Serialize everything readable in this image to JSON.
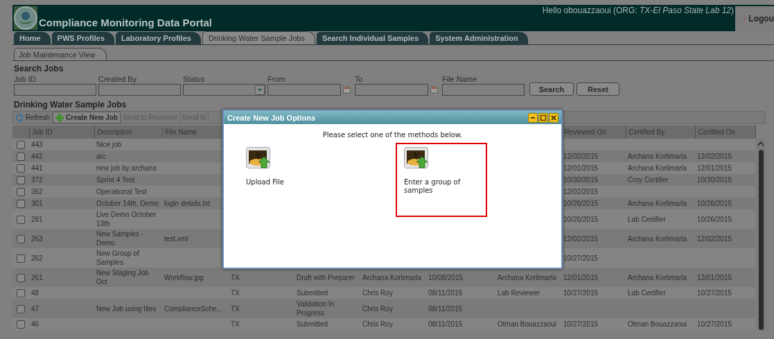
{
  "header": {
    "title": "Compliance Monitoring Data Portal",
    "greeting": "Hello obouazzaoui (ORG: *TX-El Paso State Lab 12*)",
    "logout": "Logou"
  },
  "tabs": [
    {
      "label": "Home",
      "selected": false
    },
    {
      "label": "PWS Profiles",
      "selected": false
    },
    {
      "label": "Laboratory Profiles",
      "selected": false
    },
    {
      "label": "Drinking Water Sample Jobs",
      "selected": true
    },
    {
      "label": "Search Individual Samples",
      "selected": false
    },
    {
      "label": "System Administration",
      "selected": false
    }
  ],
  "subtabs": [
    {
      "label": "Job Maintenance View",
      "selected": true
    }
  ],
  "search": {
    "title": "Search Jobs",
    "fields": [
      {
        "label": "Job ID",
        "kind": "text"
      },
      {
        "label": "Created By",
        "kind": "text"
      },
      {
        "label": "Status",
        "kind": "select"
      },
      {
        "label": "From",
        "kind": "date"
      },
      {
        "label": "To",
        "kind": "date"
      },
      {
        "label": "File Name",
        "kind": "text"
      }
    ],
    "buttons": [
      "Search",
      "Reset"
    ]
  },
  "grid": {
    "title": "Drinking Water Sample Jobs",
    "toolbar": [
      {
        "label": "Refresh",
        "kind": "refresh",
        "disabled": false
      },
      {
        "label": "Create New Job",
        "kind": "create",
        "disabled": false
      },
      {
        "label": "Send to Reviewer",
        "kind": "plain",
        "disabled": true
      },
      {
        "label": "Send to",
        "kind": "plain",
        "disabled": true
      }
    ],
    "columns": [
      "Job ID",
      "Description",
      "File Name",
      null,
      null,
      null,
      null,
      null,
      "Reviewed On",
      "Certified By",
      "Certified On"
    ],
    "rows": [
      {
        "checked": false,
        "cells": [
          "443",
          "Nice job",
          null,
          null,
          null,
          null,
          null,
          null,
          null,
          null,
          null
        ]
      },
      {
        "checked": false,
        "cells": [
          "442",
          "arc",
          null,
          null,
          null,
          null,
          null,
          null,
          "12/02/2015",
          "Archana Korlimarla",
          "12/02/2015"
        ]
      },
      {
        "checked": false,
        "cells": [
          "441",
          "new job by archana",
          null,
          null,
          null,
          null,
          null,
          null,
          "12/01/2015",
          "Archana Korlimarla",
          "12/01/2015"
        ]
      },
      {
        "checked": false,
        "cells": [
          "372",
          "Sprint 4 Test",
          null,
          null,
          null,
          null,
          null,
          null,
          "10/30/2015",
          "Croy Certifier",
          "10/30/2015"
        ]
      },
      {
        "checked": false,
        "cells": [
          "362",
          "Operational Test",
          null,
          null,
          null,
          null,
          null,
          null,
          "12/02/2015",
          null,
          null
        ]
      },
      {
        "checked": false,
        "cells": [
          "301",
          "October 14th, Demo",
          "login details.txt",
          null,
          null,
          null,
          null,
          null,
          "10/26/2015",
          "Archana Korlimarla",
          "10/26/2015"
        ]
      },
      {
        "checked": false,
        "cells": [
          "281",
          "Live Demo October 13th",
          null,
          null,
          null,
          null,
          null,
          null,
          "10/26/2015",
          "Lab Certifier",
          "10/26/2015"
        ]
      },
      {
        "checked": false,
        "cells": [
          "263",
          "New Samples - Demo",
          "test.xml",
          null,
          null,
          null,
          null,
          null,
          "12/02/2015",
          "Archana Korlimarla",
          "12/02/2015"
        ]
      },
      {
        "checked": false,
        "cells": [
          "262",
          "New Group of Samples",
          null,
          null,
          null,
          null,
          null,
          null,
          "10/27/2015",
          null,
          null
        ]
      },
      {
        "checked": false,
        "cells": [
          "261",
          "New Staging Job Oct",
          "Workflow.jpg",
          "TX",
          "Draft with Preparer",
          "Archana Korlimarla",
          "10/08/2015",
          "Archana Korlimarla",
          "12/01/2015",
          "Archana Korlimarla",
          "12/01/2015"
        ]
      },
      {
        "checked": false,
        "cells": [
          "48",
          null,
          null,
          "TX",
          "Submitted",
          "Chris Roy",
          "08/11/2015",
          "Lab Reviewer",
          "10/27/2015",
          "Lab Certifier",
          "10/27/2015"
        ]
      },
      {
        "checked": false,
        "cells": [
          "47",
          "New Job using files",
          "ComplianceSche...",
          "TX",
          "Validation In Progress",
          "Chris Roy",
          "08/11/2015",
          null,
          null,
          null,
          null
        ]
      },
      {
        "checked": false,
        "cells": [
          "46",
          null,
          null,
          "TX",
          "Submitted",
          "Chris Roy",
          "08/11/2015",
          "Otman Bouazzaoui",
          "10/27/2015",
          "Otman Bouazzaoui",
          "10/27/2015"
        ]
      }
    ]
  },
  "dialog": {
    "title": "Create New Job Options",
    "prompt": "Please select one of the methods below.",
    "options": [
      {
        "label": "Upload File",
        "selected": false
      },
      {
        "label": "Enter a group of samples",
        "selected": true
      }
    ]
  }
}
